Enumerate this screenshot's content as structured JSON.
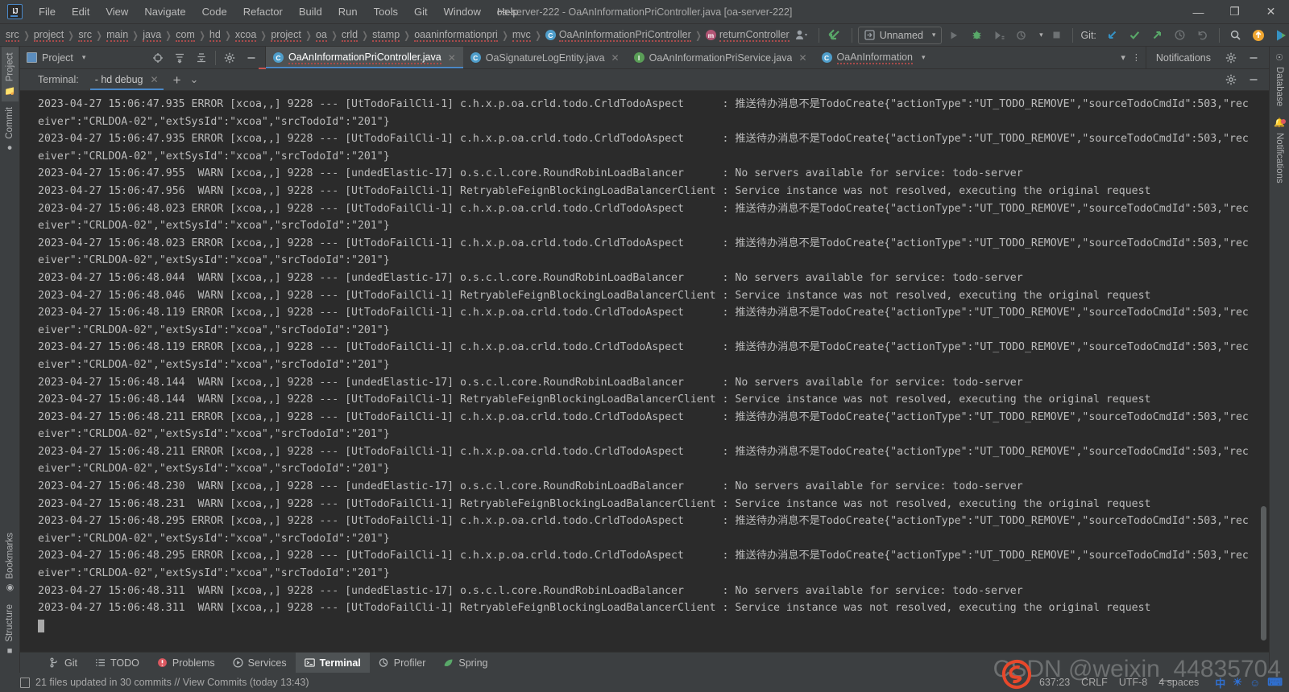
{
  "window": {
    "title": "oa-server-222 - OaAnInformationPriController.java [oa-server-222]",
    "logo_text": "IJ",
    "minimize": "—",
    "maximize": "❐",
    "close": "✕"
  },
  "menu": [
    {
      "label": "File"
    },
    {
      "label": "Edit"
    },
    {
      "label": "View"
    },
    {
      "label": "Navigate"
    },
    {
      "label": "Code"
    },
    {
      "label": "Refactor"
    },
    {
      "label": "Build"
    },
    {
      "label": "Run"
    },
    {
      "label": "Tools"
    },
    {
      "label": "Git"
    },
    {
      "label": "Window"
    },
    {
      "label": "Help"
    }
  ],
  "breadcrumb": {
    "items": [
      {
        "label": "src",
        "icon": "",
        "spell": true
      },
      {
        "label": "project",
        "icon": "",
        "spell": true
      },
      {
        "label": "src",
        "icon": "",
        "spell": true
      },
      {
        "label": "main",
        "icon": "",
        "spell": true
      },
      {
        "label": "java",
        "icon": "",
        "spell": true
      },
      {
        "label": "com",
        "icon": "",
        "spell": true
      },
      {
        "label": "hd",
        "icon": "",
        "spell": true
      },
      {
        "label": "xcoa",
        "icon": "",
        "spell": true
      },
      {
        "label": "project",
        "icon": "",
        "spell": true
      },
      {
        "label": "oa",
        "icon": "",
        "spell": true
      },
      {
        "label": "crld",
        "icon": "",
        "spell": true
      },
      {
        "label": "stamp",
        "icon": "",
        "spell": true
      },
      {
        "label": "oaaninformationpri",
        "icon": "",
        "spell": true
      },
      {
        "label": "mvc",
        "icon": "",
        "spell": true
      },
      {
        "label": "OaAnInformationPriController",
        "icon": "class",
        "icon_letter": "C",
        "spell": true
      },
      {
        "label": "returnController",
        "icon": "method",
        "icon_letter": "m",
        "spell": true
      }
    ],
    "separator": "❯"
  },
  "toolbar": {
    "profile_icon": "user-profile-icon",
    "back_arrow_icon": "back-arrow-icon",
    "run_config": "Unnamed",
    "run_config_caret": "▾",
    "run_label": "run-button",
    "debug_label": "debug-button",
    "coverage_label": "run-with-coverage-button",
    "profile_label": "profiler-button",
    "stop_label": "stop-button",
    "git_label": "Git:",
    "git_update": "update-project-icon",
    "git_commit": "commit-icon",
    "git_push": "push-icon",
    "git_history": "history-icon",
    "git_rollback": "rollback-icon",
    "search_everywhere": "search-icon",
    "updates_badge": "update-available-icon",
    "ide_action": "ide-action-icon"
  },
  "left_strip": {
    "top": [
      {
        "label": "Project",
        "icon": "folder-icon",
        "active": true
      },
      {
        "label": "Commit",
        "icon": "commit-icon",
        "active": false
      }
    ],
    "bottom": [
      {
        "label": "Bookmarks",
        "icon": "bookmark-icon",
        "active": false
      },
      {
        "label": "Structure",
        "icon": "structure-icon",
        "active": false
      }
    ]
  },
  "right_strip": {
    "items": [
      {
        "label": "Database",
        "icon": "database-icon",
        "active": false,
        "badge": false
      },
      {
        "label": "Notifications",
        "icon": "bell-icon",
        "active": false,
        "badge": true
      }
    ]
  },
  "project_panel": {
    "title": "Project",
    "caret": "▾",
    "actions": [
      {
        "name": "select-opened-file-icon"
      },
      {
        "name": "expand-all-icon"
      },
      {
        "name": "collapse-all-icon"
      },
      {
        "name": "settings-gear-icon"
      },
      {
        "name": "hide-icon"
      }
    ]
  },
  "editor_tabs": {
    "tabs": [
      {
        "label": "OaAnInformationPriController.java",
        "icon": "class",
        "icon_letter": "C",
        "active": true,
        "closable": true,
        "spell": true
      },
      {
        "label": "OaSignatureLogEntity.java",
        "icon": "class",
        "icon_letter": "C",
        "active": false,
        "closable": true,
        "spell": false
      },
      {
        "label": "OaAnInformationPriService.java",
        "icon": "interface",
        "icon_letter": "I",
        "active": false,
        "closable": true,
        "spell": false
      },
      {
        "label": "OaAnInformation",
        "icon": "class",
        "icon_letter": "C",
        "active": false,
        "closable": false,
        "spell": true
      }
    ],
    "overflow_caret": "▾",
    "more_dots": "⋮",
    "notifications_tab": "Notifications",
    "notif_actions": [
      {
        "name": "settings-gear-icon"
      },
      {
        "name": "hide-icon"
      }
    ]
  },
  "terminal_header": {
    "label": "Terminal:",
    "tab": "- hd  debug",
    "tab_close": "✕",
    "add": "+",
    "dropdown": "⌄",
    "actions": [
      {
        "name": "settings-gear-icon"
      },
      {
        "name": "hide-icon"
      }
    ]
  },
  "terminal": {
    "lines": [
      "2023-04-27 15:06:47.935 ERROR [xcoa,,] 9228 --- [UtTodoFailCli-1] c.h.x.p.oa.crld.todo.CrldTodoAspect      : 推送待办消息不是TodoCreate{\"actionType\":\"UT_TODO_REMOVE\",\"sourceTodoCmdId\":503,\"rec",
      "eiver\":\"CRLDOA-02\",\"extSysId\":\"xcoa\",\"srcTodoId\":\"201\"}",
      "2023-04-27 15:06:47.935 ERROR [xcoa,,] 9228 --- [UtTodoFailCli-1] c.h.x.p.oa.crld.todo.CrldTodoAspect      : 推送待办消息不是TodoCreate{\"actionType\":\"UT_TODO_REMOVE\",\"sourceTodoCmdId\":503,\"rec",
      "eiver\":\"CRLDOA-02\",\"extSysId\":\"xcoa\",\"srcTodoId\":\"201\"}",
      "2023-04-27 15:06:47.955  WARN [xcoa,,] 9228 --- [undedElastic-17] o.s.c.l.core.RoundRobinLoadBalancer      : No servers available for service: todo-server",
      "2023-04-27 15:06:47.956  WARN [xcoa,,] 9228 --- [UtTodoFailCli-1] RetryableFeignBlockingLoadBalancerClient : Service instance was not resolved, executing the original request",
      "2023-04-27 15:06:48.023 ERROR [xcoa,,] 9228 --- [UtTodoFailCli-1] c.h.x.p.oa.crld.todo.CrldTodoAspect      : 推送待办消息不是TodoCreate{\"actionType\":\"UT_TODO_REMOVE\",\"sourceTodoCmdId\":503,\"rec",
      "eiver\":\"CRLDOA-02\",\"extSysId\":\"xcoa\",\"srcTodoId\":\"201\"}",
      "2023-04-27 15:06:48.023 ERROR [xcoa,,] 9228 --- [UtTodoFailCli-1] c.h.x.p.oa.crld.todo.CrldTodoAspect      : 推送待办消息不是TodoCreate{\"actionType\":\"UT_TODO_REMOVE\",\"sourceTodoCmdId\":503,\"rec",
      "eiver\":\"CRLDOA-02\",\"extSysId\":\"xcoa\",\"srcTodoId\":\"201\"}",
      "2023-04-27 15:06:48.044  WARN [xcoa,,] 9228 --- [undedElastic-17] o.s.c.l.core.RoundRobinLoadBalancer      : No servers available for service: todo-server",
      "2023-04-27 15:06:48.046  WARN [xcoa,,] 9228 --- [UtTodoFailCli-1] RetryableFeignBlockingLoadBalancerClient : Service instance was not resolved, executing the original request",
      "2023-04-27 15:06:48.119 ERROR [xcoa,,] 9228 --- [UtTodoFailCli-1] c.h.x.p.oa.crld.todo.CrldTodoAspect      : 推送待办消息不是TodoCreate{\"actionType\":\"UT_TODO_REMOVE\",\"sourceTodoCmdId\":503,\"rec",
      "eiver\":\"CRLDOA-02\",\"extSysId\":\"xcoa\",\"srcTodoId\":\"201\"}",
      "2023-04-27 15:06:48.119 ERROR [xcoa,,] 9228 --- [UtTodoFailCli-1] c.h.x.p.oa.crld.todo.CrldTodoAspect      : 推送待办消息不是TodoCreate{\"actionType\":\"UT_TODO_REMOVE\",\"sourceTodoCmdId\":503,\"rec",
      "eiver\":\"CRLDOA-02\",\"extSysId\":\"xcoa\",\"srcTodoId\":\"201\"}",
      "2023-04-27 15:06:48.144  WARN [xcoa,,] 9228 --- [undedElastic-17] o.s.c.l.core.RoundRobinLoadBalancer      : No servers available for service: todo-server",
      "2023-04-27 15:06:48.144  WARN [xcoa,,] 9228 --- [UtTodoFailCli-1] RetryableFeignBlockingLoadBalancerClient : Service instance was not resolved, executing the original request",
      "2023-04-27 15:06:48.211 ERROR [xcoa,,] 9228 --- [UtTodoFailCli-1] c.h.x.p.oa.crld.todo.CrldTodoAspect      : 推送待办消息不是TodoCreate{\"actionType\":\"UT_TODO_REMOVE\",\"sourceTodoCmdId\":503,\"rec",
      "eiver\":\"CRLDOA-02\",\"extSysId\":\"xcoa\",\"srcTodoId\":\"201\"}",
      "2023-04-27 15:06:48.211 ERROR [xcoa,,] 9228 --- [UtTodoFailCli-1] c.h.x.p.oa.crld.todo.CrldTodoAspect      : 推送待办消息不是TodoCreate{\"actionType\":\"UT_TODO_REMOVE\",\"sourceTodoCmdId\":503,\"rec",
      "eiver\":\"CRLDOA-02\",\"extSysId\":\"xcoa\",\"srcTodoId\":\"201\"}",
      "2023-04-27 15:06:48.230  WARN [xcoa,,] 9228 --- [undedElastic-17] o.s.c.l.core.RoundRobinLoadBalancer      : No servers available for service: todo-server",
      "2023-04-27 15:06:48.231  WARN [xcoa,,] 9228 --- [UtTodoFailCli-1] RetryableFeignBlockingLoadBalancerClient : Service instance was not resolved, executing the original request",
      "2023-04-27 15:06:48.295 ERROR [xcoa,,] 9228 --- [UtTodoFailCli-1] c.h.x.p.oa.crld.todo.CrldTodoAspect      : 推送待办消息不是TodoCreate{\"actionType\":\"UT_TODO_REMOVE\",\"sourceTodoCmdId\":503,\"rec",
      "eiver\":\"CRLDOA-02\",\"extSysId\":\"xcoa\",\"srcTodoId\":\"201\"}",
      "2023-04-27 15:06:48.295 ERROR [xcoa,,] 9228 --- [UtTodoFailCli-1] c.h.x.p.oa.crld.todo.CrldTodoAspect      : 推送待办消息不是TodoCreate{\"actionType\":\"UT_TODO_REMOVE\",\"sourceTodoCmdId\":503,\"rec",
      "eiver\":\"CRLDOA-02\",\"extSysId\":\"xcoa\",\"srcTodoId\":\"201\"}",
      "2023-04-27 15:06:48.311  WARN [xcoa,,] 9228 --- [undedElastic-17] o.s.c.l.core.RoundRobinLoadBalancer      : No servers available for service: todo-server",
      "2023-04-27 15:06:48.311  WARN [xcoa,,] 9228 --- [UtTodoFailCli-1] RetryableFeignBlockingLoadBalancerClient : Service instance was not resolved, executing the original request"
    ]
  },
  "bottom_tabs": [
    {
      "label": "Git",
      "icon": "git-branch-icon",
      "active": false
    },
    {
      "label": "TODO",
      "icon": "todo-list-icon",
      "active": false
    },
    {
      "label": "Problems",
      "icon": "problems-error-icon",
      "active": false
    },
    {
      "label": "Services",
      "icon": "services-play-icon",
      "active": false
    },
    {
      "label": "Terminal",
      "icon": "terminal-icon",
      "active": true
    },
    {
      "label": "Profiler",
      "icon": "profiler-icon",
      "active": false
    },
    {
      "label": "Spring",
      "icon": "spring-leaf-icon",
      "active": false
    }
  ],
  "status_bar": {
    "message": "21 files updated in 30 commits // View Commits (today 13:43)",
    "caret_position": "637:23",
    "line_separator": "CRLF",
    "encoding": "UTF-8",
    "indent": "4 spaces",
    "tray": [
      "中",
      "☀",
      "☺",
      "⌨"
    ]
  },
  "watermark": {
    "text": "CSDN @weixin_44835704"
  },
  "colors": {
    "accent_blue": "#4a88c7",
    "terminal_bg": "#2b2b2b",
    "chrome_bg": "#3c3f41",
    "text": "#bbbbbb",
    "error_red": "#c75450",
    "green": "#59a869"
  }
}
